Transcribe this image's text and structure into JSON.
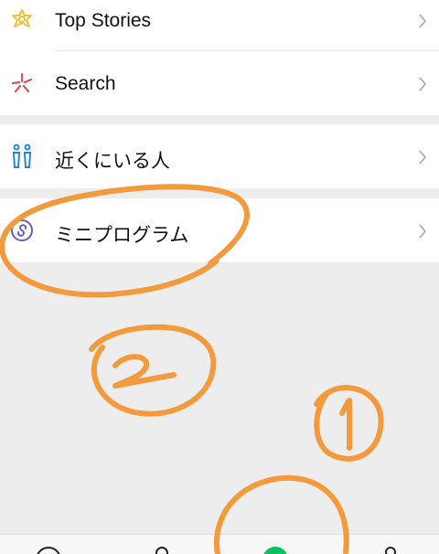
{
  "menu": {
    "top_stories": {
      "label": "Top Stories",
      "icon": "top-stories-icon"
    },
    "search": {
      "label": "Search",
      "icon": "search-icon"
    },
    "people_nearby": {
      "label": "近くにいる人",
      "icon": "people-nearby-icon"
    },
    "mini_programs": {
      "label": "ミニプログラム",
      "icon": "mini-program-icon"
    }
  },
  "tabbar": {
    "tabs": [
      {
        "icon": "chats-icon"
      },
      {
        "icon": "contacts-icon"
      },
      {
        "icon": "discover-icon",
        "active": true
      },
      {
        "icon": "me-icon"
      }
    ]
  },
  "annotations": {
    "marks": [
      "2",
      "1"
    ],
    "color": "#f39a3c"
  },
  "colors": {
    "accent_green": "#07c160",
    "annotation_orange": "#f39a3c",
    "background": "#ededed",
    "icon_yellow": "#f1c232",
    "icon_red": "#e2525a",
    "icon_blue": "#2b83d6",
    "icon_purple": "#6b5ac8"
  }
}
